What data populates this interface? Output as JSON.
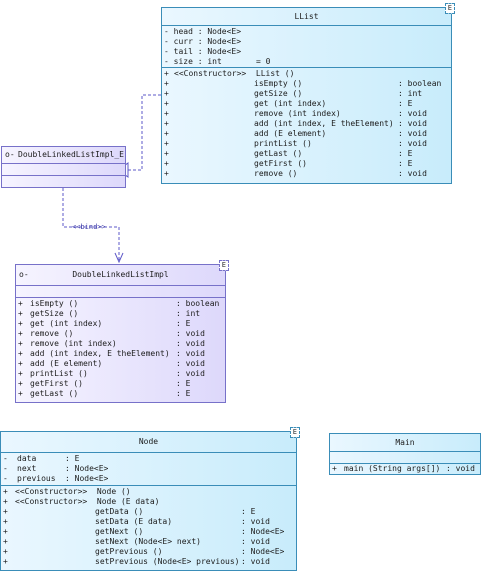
{
  "classes": {
    "llist": {
      "title": "LList",
      "template_param": "E",
      "attributes": [
        "- head : Node<E>",
        "- curr : Node<E>",
        "- tail : Node<E>",
        "- size : int",
        "= 0"
      ],
      "constructor": {
        "vis": "+",
        "name": "<<Constructor>>  LList ()"
      },
      "methods": [
        {
          "vis": "+",
          "name": "isEmpty ()",
          "type": ": boolean"
        },
        {
          "vis": "+",
          "name": "getSize ()",
          "type": ": int"
        },
        {
          "vis": "+",
          "name": "get (int index)",
          "type": ": E"
        },
        {
          "vis": "+",
          "name": "remove (int index)",
          "type": ": void"
        },
        {
          "vis": "+",
          "name": "add (int index, E theElement)",
          "type": ": void"
        },
        {
          "vis": "+",
          "name": "add (E element)",
          "type": ": void"
        },
        {
          "vis": "+",
          "name": "printList ()",
          "type": ": void"
        },
        {
          "vis": "+",
          "name": "getLast ()",
          "type": ": E"
        },
        {
          "vis": "+",
          "name": "getFirst ()",
          "type": ": E"
        },
        {
          "vis": "+",
          "name": "remove ()",
          "type": ": void"
        }
      ]
    },
    "bound_impl": {
      "title": "DoubleLinkedListImpl_E",
      "icon_text": "o-"
    },
    "impl": {
      "title": "DoubleLinkedListImpl",
      "icon_text": "o-",
      "template_param": "E",
      "methods": [
        {
          "vis": "+",
          "name": "isEmpty ()",
          "type": ": boolean"
        },
        {
          "vis": "+",
          "name": "getSize ()",
          "type": ": int"
        },
        {
          "vis": "+",
          "name": "get (int index)",
          "type": ": E"
        },
        {
          "vis": "+",
          "name": "remove ()",
          "type": ": void"
        },
        {
          "vis": "+",
          "name": "remove (int index)",
          "type": ": void"
        },
        {
          "vis": "+",
          "name": "add (int index, E theElement)",
          "type": ": void"
        },
        {
          "vis": "+",
          "name": "add (E element)",
          "type": ": void"
        },
        {
          "vis": "+",
          "name": "printList ()",
          "type": ": void"
        },
        {
          "vis": "+",
          "name": "getFirst ()",
          "type": ": E"
        },
        {
          "vis": "+",
          "name": "getLast ()",
          "type": ": E"
        }
      ]
    },
    "node": {
      "title": "Node",
      "template_param": "E",
      "attributes": [
        {
          "vis": "-",
          "name": "data",
          "type": ": E"
        },
        {
          "vis": "-",
          "name": "next",
          "type": ": Node<E>"
        },
        {
          "vis": "-",
          "name": "previous",
          "type": ": Node<E>"
        }
      ],
      "constructors": [
        {
          "vis": "+",
          "name": "<<Constructor>>  Node ()"
        },
        {
          "vis": "+",
          "name": "<<Constructor>>  Node (E data)"
        }
      ],
      "methods": [
        {
          "vis": "+",
          "name": "getData ()",
          "type": ": E"
        },
        {
          "vis": "+",
          "name": "setData (E data)",
          "type": ": void"
        },
        {
          "vis": "+",
          "name": "getNext ()",
          "type": ": Node<E>"
        },
        {
          "vis": "+",
          "name": "setNext (Node<E> next)",
          "type": ": void"
        },
        {
          "vis": "+",
          "name": "getPrevious ()",
          "type": ": Node<E>"
        },
        {
          "vis": "+",
          "name": "setPrevious (Node<E> previous)",
          "type": ": void"
        }
      ]
    },
    "main": {
      "title": "Main",
      "methods": [
        {
          "vis": "+",
          "name": "main (String args[])",
          "type": ": void"
        }
      ]
    }
  },
  "bind_label": "<<bind>>",
  "colors": {
    "blue_border": "#3a8db8",
    "purple_border": "#7771c9",
    "connector": "#5d58c8"
  }
}
